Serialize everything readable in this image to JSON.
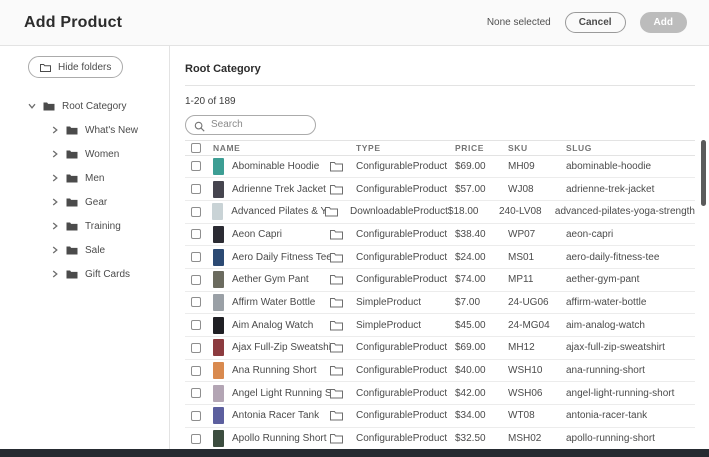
{
  "header": {
    "title": "Add Product",
    "selection_status": "None selected",
    "cancel_label": "Cancel",
    "add_label": "Add"
  },
  "sidebar": {
    "hide_folders_label": "Hide folders",
    "root": {
      "label": "Root Category"
    },
    "items": [
      {
        "label": "What's New"
      },
      {
        "label": "Women"
      },
      {
        "label": "Men"
      },
      {
        "label": "Gear"
      },
      {
        "label": "Training"
      },
      {
        "label": "Sale"
      },
      {
        "label": "Gift Cards"
      }
    ]
  },
  "main": {
    "heading": "Root Category",
    "result_count": "1-20 of 189",
    "search_placeholder": "Search",
    "table": {
      "columns": [
        "NAME",
        "TYPE",
        "PRICE",
        "SKU",
        "SLUG"
      ],
      "rows": [
        {
          "name": "Abominable Hoodie",
          "type": "ConfigurableProduct",
          "price": "$69.00",
          "sku": "MH09",
          "slug": "abominable-hoodie",
          "thumb_color": "#3d9e94"
        },
        {
          "name": "Adrienne Trek Jacket",
          "type": "ConfigurableProduct",
          "price": "$57.00",
          "sku": "WJ08",
          "slug": "adrienne-trek-jacket",
          "thumb_color": "#46454f"
        },
        {
          "name": "Advanced Pilates & Yoga (",
          "type": "DownloadableProduct",
          "price": "$18.00",
          "sku": "240-LV08",
          "slug": "advanced-pilates-yoga-strength",
          "thumb_color": "#c9d3d6"
        },
        {
          "name": "Aeon Capri",
          "type": "ConfigurableProduct",
          "price": "$38.40",
          "sku": "WP07",
          "slug": "aeon-capri",
          "thumb_color": "#2b2b33"
        },
        {
          "name": "Aero Daily Fitness Tee",
          "type": "ConfigurableProduct",
          "price": "$24.00",
          "sku": "MS01",
          "slug": "aero-daily-fitness-tee",
          "thumb_color": "#2c4a73"
        },
        {
          "name": "Aether Gym Pant",
          "type": "ConfigurableProduct",
          "price": "$74.00",
          "sku": "MP11",
          "slug": "aether-gym-pant",
          "thumb_color": "#6b6b5f"
        },
        {
          "name": "Affirm Water Bottle",
          "type": "SimpleProduct",
          "price": "$7.00",
          "sku": "24-UG06",
          "slug": "affirm-water-bottle",
          "thumb_color": "#9aa0a6"
        },
        {
          "name": "Aim Analog Watch",
          "type": "SimpleProduct",
          "price": "$45.00",
          "sku": "24-MG04",
          "slug": "aim-analog-watch",
          "thumb_color": "#1f1f24"
        },
        {
          "name": "Ajax Full-Zip Sweatshirt",
          "type": "ConfigurableProduct",
          "price": "$69.00",
          "sku": "MH12",
          "slug": "ajax-full-zip-sweatshirt",
          "thumb_color": "#8c3b3f"
        },
        {
          "name": "Ana Running Short",
          "type": "ConfigurableProduct",
          "price": "$40.00",
          "sku": "WSH10",
          "slug": "ana-running-short",
          "thumb_color": "#d98a4f"
        },
        {
          "name": "Angel Light Running Shor",
          "type": "ConfigurableProduct",
          "price": "$42.00",
          "sku": "WSH06",
          "slug": "angel-light-running-short",
          "thumb_color": "#b3a5b4"
        },
        {
          "name": "Antonia Racer Tank",
          "type": "ConfigurableProduct",
          "price": "$34.00",
          "sku": "WT08",
          "slug": "antonia-racer-tank",
          "thumb_color": "#5c5f9e"
        },
        {
          "name": "Apollo Running Short",
          "type": "ConfigurableProduct",
          "price": "$32.50",
          "sku": "MSH02",
          "slug": "apollo-running-short",
          "thumb_color": "#3c4d3f"
        }
      ]
    }
  }
}
